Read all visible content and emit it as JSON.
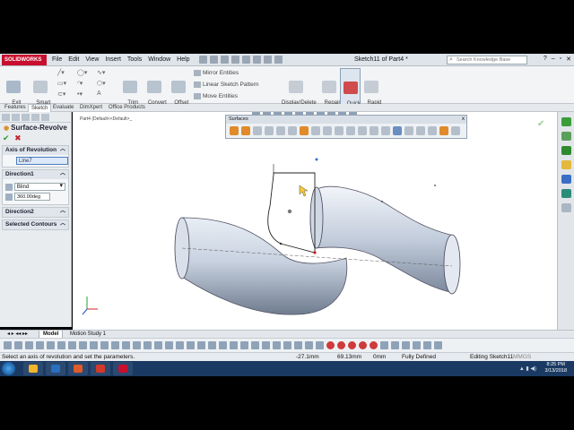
{
  "app": {
    "logo": "SOLIDWORKS",
    "menu": [
      "File",
      "Edit",
      "View",
      "Insert",
      "Tools",
      "Window",
      "Help"
    ],
    "document_title": "Sketch11 of Part4 *",
    "search_placeholder": "Search Knowledge Base",
    "window_controls": [
      "?",
      "–",
      "▫",
      "✕"
    ]
  },
  "command_manager": {
    "exit_sketch": "Exit\nSketch",
    "smart_dimension": "Smart\nDimension",
    "trim_entities": "Trim\nEntities",
    "convert_entities": "Convert\nEntities",
    "offset_entities": "Offset\nEntities",
    "mirror_entities": "Mirror Entities",
    "linear_sketch_pattern": "Linear Sketch Pattern",
    "move_entities": "Move Entities",
    "display_delete_relations": "Display/Delete\nRelations",
    "repair_sketch": "Repair\nSketch",
    "quick_snaps": "Quick\nSnaps",
    "rapid_sketch": "Rapid\nSketch"
  },
  "tabs": [
    "Features",
    "Sketch",
    "Evaluate",
    "DimXpert",
    "Office Products"
  ],
  "property_manager": {
    "title": "Surface-Revolve",
    "ok": "✔",
    "cancel": "✖",
    "axis_group": "Axis of Revolution",
    "axis_value": "Line7",
    "direction1_group": "Direction1",
    "end_condition": "Blind",
    "angle": "360.00deg",
    "direction2_group": "Direction2",
    "selected_contours_group": "Selected Contours"
  },
  "viewport": {
    "tree_item": "Part4 (Default<<Default>_",
    "surfaces_toolbar_title": "Surfaces",
    "surfaces_toolbar_close": "x"
  },
  "bottom_tabs": [
    "Model",
    "Motion Study 1"
  ],
  "status": {
    "message": "Select an axis of revolution and set the parameters.",
    "x": "-27.1mm",
    "y": "69.13mm",
    "z": "0mm",
    "state": "Fully Defined",
    "editing": "Editing Sketch11",
    "units": "MMGS"
  },
  "taskbar": {
    "time": "8:25 PM",
    "date": "3/13/2018",
    "app_colors": [
      "#f2b62a",
      "#2b6fc0",
      "#e05a2a",
      "#d23a2a",
      "#c8102e"
    ]
  }
}
